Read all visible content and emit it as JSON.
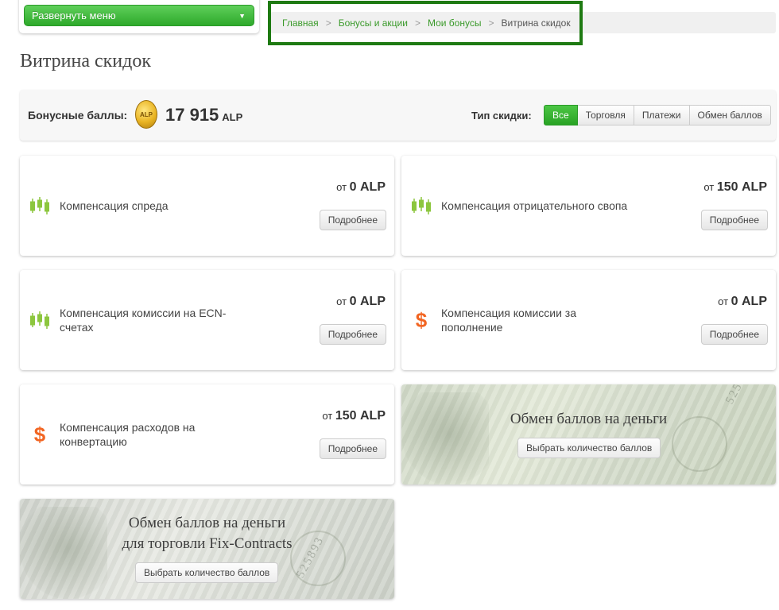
{
  "menu": {
    "label": "Развернуть меню"
  },
  "breadcrumb": {
    "items": [
      "Главная",
      "Бонусы и акции",
      "Мои бонусы"
    ],
    "current": "Витрина скидок",
    "separator": ">"
  },
  "page": {
    "title": "Витрина скидок"
  },
  "bonus": {
    "label": "Бонусные баллы:",
    "coin_text": "ALP",
    "amount": "17 915",
    "unit": "ALP",
    "type_label": "Тип скидки:",
    "filters": [
      {
        "label": "Все",
        "active": true
      },
      {
        "label": "Торговля",
        "active": false
      },
      {
        "label": "Платежи",
        "active": false
      },
      {
        "label": "Обмен баллов",
        "active": false
      }
    ]
  },
  "cards": [
    {
      "title": "Компенсация спреда",
      "price_prefix": "от",
      "price": "0 ALP",
      "button": "Подробнее",
      "icon": "candlestick-icon"
    },
    {
      "title": "Компенсация отрицательного свопа",
      "price_prefix": "от",
      "price": "150 ALP",
      "button": "Подробнее",
      "icon": "candlestick-icon"
    },
    {
      "title": "Компенсация комиссии на ECN-счетах",
      "price_prefix": "от",
      "price": "0 ALP",
      "button": "Подробнее",
      "icon": "candlestick-icon"
    },
    {
      "title": "Компенсация комиссии за пополнение",
      "price_prefix": "от",
      "price": "0 ALP",
      "button": "Подробнее",
      "icon": "dollar-icon"
    },
    {
      "title": "Компенсация расходов на конвертацию",
      "price_prefix": "от",
      "price": "150 ALP",
      "button": "Подробнее",
      "icon": "dollar-icon"
    }
  ],
  "money_cards": [
    {
      "title_line1": "Обмен баллов на деньги",
      "title_line2": "",
      "button": "Выбрать количество баллов",
      "serial": "525893"
    },
    {
      "title_line1": "Обмен баллов на деньги",
      "title_line2": "для торговли Fix-Contracts",
      "button": "Выбрать количество баллов",
      "serial": "525893"
    }
  ],
  "colors": {
    "accent_green": "#2ea92b",
    "breadcrumb_link": "#3a9a2a",
    "highlight_frame": "#1e7a12",
    "candle_green": "#8cc63e",
    "dollar_orange": "#f26522"
  }
}
